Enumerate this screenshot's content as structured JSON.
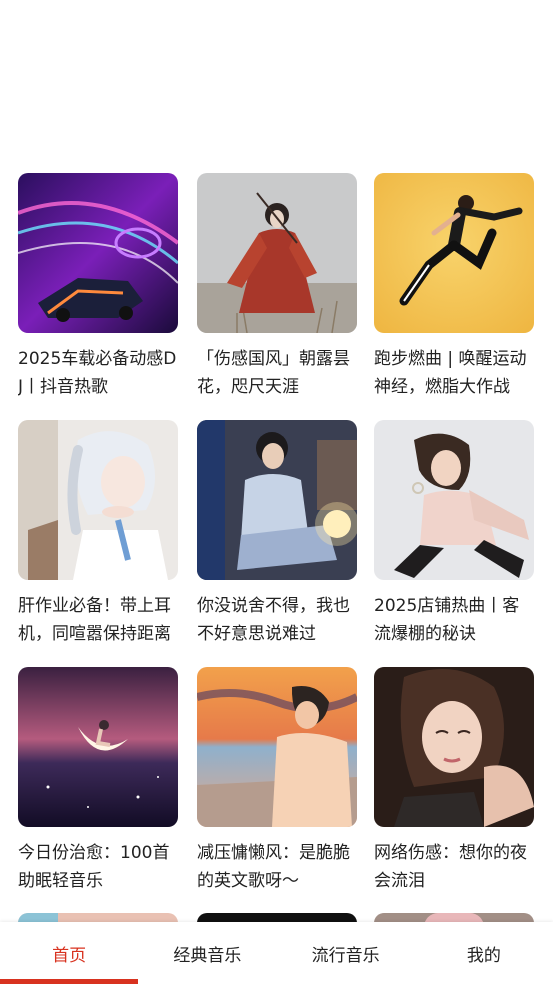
{
  "playlists": [
    {
      "title": "2025车载必备动感DJ丨抖音热歌"
    },
    {
      "title": "「伤感国风」朝露昙花，咫尺天涯"
    },
    {
      "title": "跑步燃曲 | 唤醒运动神经，燃脂大作战"
    },
    {
      "title": "肝作业必备！带上耳机，同喧嚣保持距离"
    },
    {
      "title": "你没说舍不得，我也不好意思说难过"
    },
    {
      "title": "2025店铺热曲丨客流爆棚的秘诀"
    },
    {
      "title": "今日份治愈：100首助眠轻音乐"
    },
    {
      "title": "减压慵懒风：是脆脆的英文歌呀～"
    },
    {
      "title": "网络伤感：想你的夜会流泪"
    }
  ],
  "tabs": [
    {
      "label": "首页",
      "active": true
    },
    {
      "label": "经典音乐",
      "active": false
    },
    {
      "label": "流行音乐",
      "active": false
    },
    {
      "label": "我的",
      "active": false
    }
  ],
  "colors": {
    "accent": "#d8321f"
  }
}
